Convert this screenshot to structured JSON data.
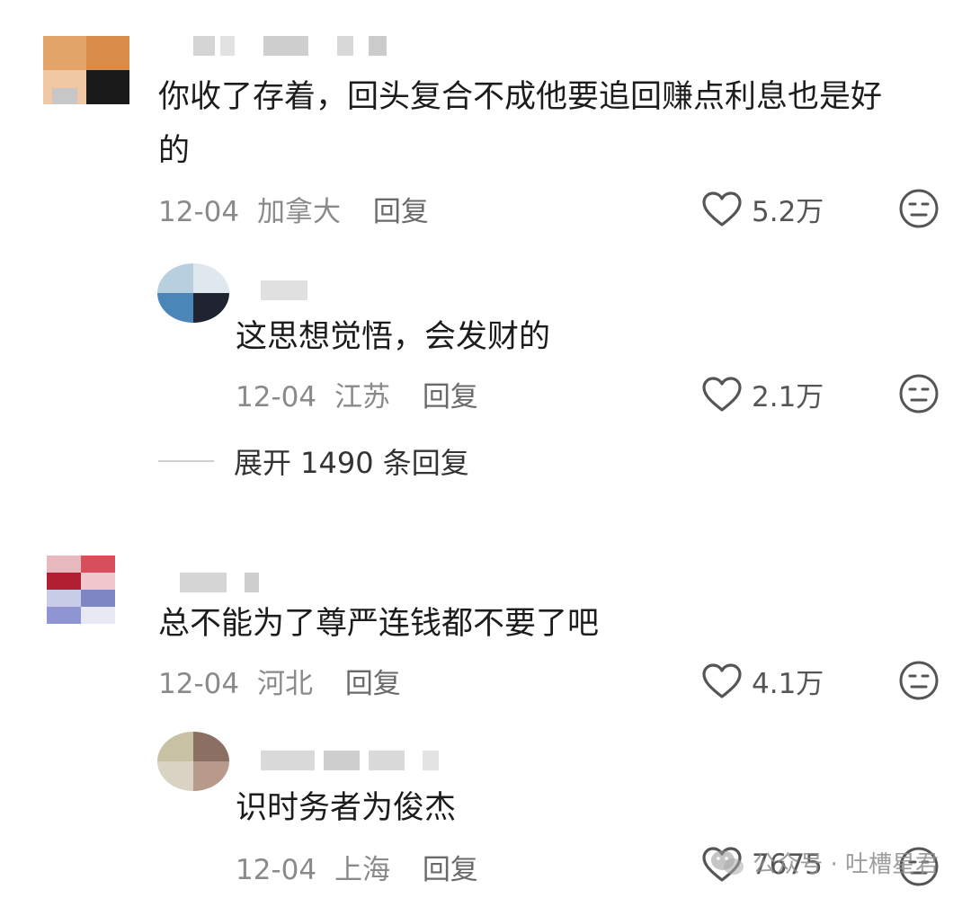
{
  "comments": [
    {
      "text_line1": "你收了存着，回头复合不成他要追回赚点利息也是好",
      "text_line2": "的",
      "date": "12-04",
      "location": "加拿大",
      "reply_label": "回复",
      "likes": "5.2万",
      "replies": [
        {
          "text": "这思想觉悟，会发财的",
          "date": "12-04",
          "location": "江苏",
          "reply_label": "回复",
          "likes": "2.1万"
        }
      ],
      "expand_label": "展开 1490 条回复"
    },
    {
      "text_line1": "总不能为了尊严连钱都不要了吧",
      "date": "12-04",
      "location": "河北",
      "reply_label": "回复",
      "likes": "4.1万",
      "replies": [
        {
          "text": "识时务者为俊杰",
          "date": "12-04",
          "location": "上海",
          "reply_label": "回复",
          "likes": "7675"
        }
      ]
    }
  ],
  "watermark": "公众号 · 吐槽星君",
  "colors": {
    "text": "#1c1c1c",
    "meta": "#8a8a8a",
    "icon": "#555555"
  },
  "icons": {
    "like": "heart-outline-icon",
    "dislike": "meh-face-icon",
    "watermark": "wechat-icon"
  }
}
